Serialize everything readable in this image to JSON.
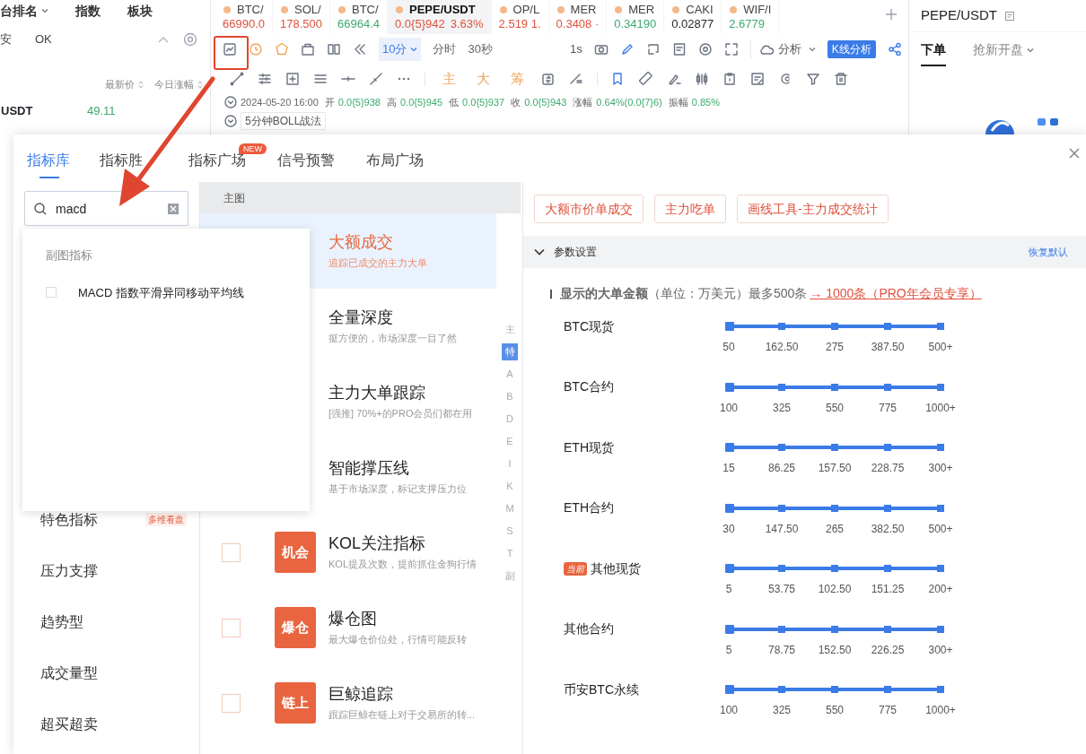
{
  "market_panel": {
    "tabs": [
      {
        "label": "台排名",
        "dropdown": true
      },
      {
        "label": "指数",
        "dropdown": false
      },
      {
        "label": "板块",
        "dropdown": false
      }
    ],
    "filters": [
      "安",
      "OK"
    ],
    "columns": [
      "最新价",
      "今日涨幅"
    ],
    "rows": [
      {
        "symbol": "USDT",
        "price": "49.11"
      }
    ]
  },
  "tickers": [
    {
      "symbol": "BTC/",
      "price": "66990.0",
      "color": "#e0513c",
      "selected": false
    },
    {
      "symbol": "SOL/",
      "price": "178.500",
      "color": "#e0513c",
      "selected": false
    },
    {
      "symbol": "BTC/",
      "price": "66964.4",
      "color": "#3daa6e",
      "selected": false
    },
    {
      "symbol": "PEPE/USDT",
      "price": "0.0{5}942",
      "change": "3.63%",
      "color": "#e0513c",
      "selected": true
    },
    {
      "symbol": "OP/L",
      "price": "2.519 1.",
      "color": "#e0513c",
      "selected": false
    },
    {
      "symbol": "MER",
      "price": "0.3408 ·",
      "color": "#e0513c",
      "selected": false
    },
    {
      "symbol": "MER",
      "price": "0.34190",
      "color": "#3daa6e",
      "selected": false
    },
    {
      "symbol": "CAKI",
      "price": "0.02877",
      "color": "#1f2328",
      "selected": false
    },
    {
      "symbol": "WIF/I",
      "price": "2.6779",
      "color": "#3daa6e",
      "selected": false
    }
  ],
  "toolbar": {
    "intervals": [
      {
        "label": "10分",
        "selected": true,
        "dropdown": true
      },
      {
        "label": "分时",
        "selected": false,
        "dropdown": false
      },
      {
        "label": "30秒",
        "selected": false,
        "dropdown": false
      }
    ],
    "second_interval": "1s",
    "analysis_menu": "分析",
    "kline_button": "K线分析",
    "chips": [
      "主",
      "大",
      "筹"
    ]
  },
  "bar_info": {
    "time": "2024-05-20 16:00",
    "fields": [
      {
        "label": "开",
        "value": "0.0{5}938"
      },
      {
        "label": "高",
        "value": "0.0{5}945"
      },
      {
        "label": "低",
        "value": "0.0{5}937"
      },
      {
        "label": "收",
        "value": "0.0{5}943"
      },
      {
        "label": "涨幅",
        "value": "0.64%(0.0{7}6)"
      },
      {
        "label": "振幅",
        "value": "0.85%"
      }
    ],
    "strategy": "5分钟BOLL战法"
  },
  "trade_panel": {
    "symbol": "PEPE/USDT",
    "tabs": [
      {
        "label": "下单",
        "selected": true,
        "dropdown": false
      },
      {
        "label": "抢新开盘",
        "selected": false,
        "dropdown": true
      }
    ]
  },
  "indicator_dialog": {
    "tabs": [
      {
        "label": "指标库",
        "selected": true
      },
      {
        "label": "指标胜",
        "selected": false
      },
      {
        "label": "指标广场",
        "selected": false,
        "badge": "NEW"
      },
      {
        "label": "信号预警",
        "selected": false
      },
      {
        "label": "布局广场",
        "selected": false
      }
    ],
    "search": {
      "value": "macd"
    },
    "search_results": {
      "heading": "副图指标",
      "items": [
        {
          "label": "MACD 指数平滑异同移动平均线",
          "checked": false
        }
      ]
    },
    "categories": [
      {
        "label": "特色指标",
        "tag": "多维看盘"
      },
      {
        "label": "压力支撑"
      },
      {
        "label": "趋势型"
      },
      {
        "label": "成交量型"
      },
      {
        "label": "超买超卖"
      }
    ],
    "list_header": "主图",
    "indicators": [
      {
        "title": "大额成交",
        "desc": "追踪已成交的主力大单",
        "selected": true
      },
      {
        "title": "全量深度",
        "desc": "挺方便的，市场深度一目了然",
        "selected": false
      },
      {
        "title": "主力大单跟踪",
        "desc": "[强推] 70%+的PRO会员们都在用",
        "selected": false
      },
      {
        "title": "智能撑压线",
        "desc": "基于市场深度，标记支撑压力位",
        "selected": false
      },
      {
        "title": "KOL关注指标",
        "desc": "KOL提及次数，提前抓住金狗行情",
        "selected": false,
        "tag": "机会",
        "checked": false
      },
      {
        "title": "爆仓图",
        "desc": "最大爆仓价位处，行情可能反转",
        "selected": false,
        "tag": "爆仓",
        "checked": false
      },
      {
        "title": "巨鲸追踪",
        "desc": "跟踪巨鲸在链上对于交易所的转...",
        "selected": false,
        "tag": "链上",
        "checked": false
      }
    ],
    "index": [
      {
        "label": "主",
        "selected": false
      },
      {
        "label": "特",
        "selected": true
      },
      {
        "label": "A",
        "selected": false
      },
      {
        "label": "B",
        "selected": false
      },
      {
        "label": "D",
        "selected": false
      },
      {
        "label": "E",
        "selected": false
      },
      {
        "label": "I",
        "selected": false
      },
      {
        "label": "K",
        "selected": false
      },
      {
        "label": "M",
        "selected": false
      },
      {
        "label": "S",
        "selected": false
      },
      {
        "label": "T",
        "selected": false
      },
      {
        "label": "副",
        "selected": false
      }
    ],
    "presets": [
      "大额市价单成交",
      "主力吃单",
      "画线工具-主力成交统计"
    ],
    "settings": {
      "title": "参数设置",
      "expanded": true,
      "reset": "恢复默认",
      "heading": "**显示的大单金额**（单位：万美元）最多500条",
      "upgrade_link": "→ 1000条（PRO年会员专享）",
      "sliders": [
        {
          "label": "BTC现货",
          "level": 0,
          "stops": [
            "50",
            "162.50",
            "275",
            "387.50",
            "500+"
          ]
        },
        {
          "label": "BTC合约",
          "level": 0,
          "stops": [
            "100",
            "325",
            "550",
            "775",
            "1000+"
          ]
        },
        {
          "label": "ETH现货",
          "level": 0,
          "stops": [
            "15",
            "86.25",
            "157.50",
            "228.75",
            "300+"
          ]
        },
        {
          "label": "ETH合约",
          "level": 0,
          "stops": [
            "30",
            "147.50",
            "265",
            "382.50",
            "500+"
          ]
        },
        {
          "label": "其他现货",
          "badge": "当前",
          "level": 0,
          "stops": [
            "5",
            "53.75",
            "102.50",
            "151.25",
            "200+"
          ]
        },
        {
          "label": "其他合约",
          "level": 0,
          "stops": [
            "5",
            "78.75",
            "152.50",
            "226.25",
            "300+"
          ]
        },
        {
          "label": "币安BTC永续",
          "level": 0,
          "stops": [
            "100",
            "325",
            "550",
            "775",
            "1000+"
          ]
        }
      ]
    }
  }
}
